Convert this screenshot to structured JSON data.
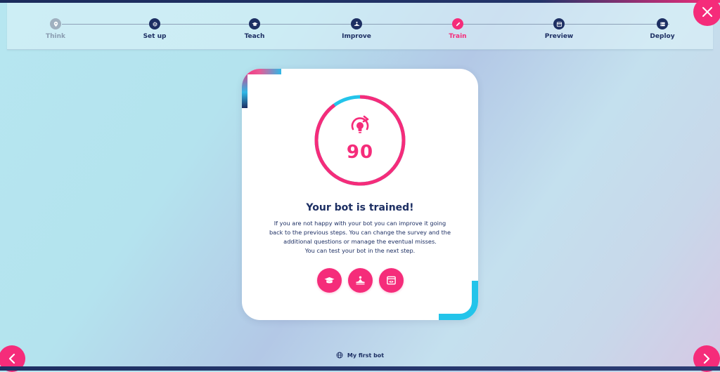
{
  "stepper": {
    "steps": [
      {
        "label": "Think",
        "icon": "pin-icon",
        "state": "inactive"
      },
      {
        "label": "Set up",
        "icon": "gear-icon",
        "state": "done"
      },
      {
        "label": "Teach",
        "icon": "graduation-cap-icon",
        "state": "done"
      },
      {
        "label": "Improve",
        "icon": "meditation-icon",
        "state": "done"
      },
      {
        "label": "Train",
        "icon": "pencil-icon",
        "state": "active"
      },
      {
        "label": "Preview",
        "icon": "calendar-icon",
        "state": "upcoming"
      },
      {
        "label": "Deploy",
        "icon": "server-icon",
        "state": "upcoming"
      }
    ]
  },
  "card": {
    "score": "90",
    "score_fraction": 0.9,
    "title": "Your bot is trained!",
    "text_lines": [
      "If you are not happy with your bot you can improve it going",
      "back to the previous steps. You can change the survey and the",
      "additional questions or manage the eventual misses.",
      "You can test your bot in the next step."
    ],
    "actions": [
      {
        "name": "teach",
        "icon": "graduation-cap-icon"
      },
      {
        "name": "improve",
        "icon": "meditation-icon"
      },
      {
        "name": "preview",
        "icon": "preview-window-icon"
      }
    ]
  },
  "footer": {
    "bot_name": "My first bot",
    "icon": "globe-icon"
  },
  "colors": {
    "accent": "#f52c7a",
    "navy": "#1d2f63",
    "cyan": "#23c4ea",
    "inactive": "#9fb0bf"
  }
}
